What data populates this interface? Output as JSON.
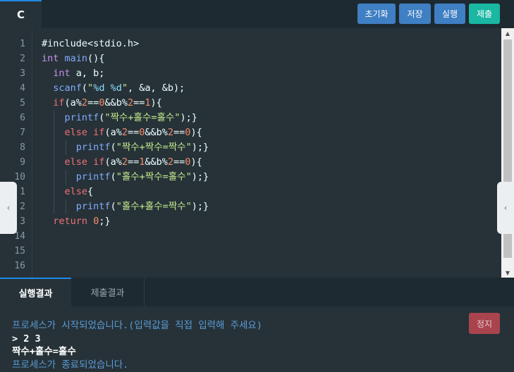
{
  "language_tab": "C",
  "toolbar": {
    "reset_label": "초기화",
    "save_label": "저장",
    "run_label": "실행",
    "submit_label": "제출"
  },
  "colors": {
    "accent": "#1e88e5",
    "run": "#3f7fc3",
    "submit": "#1ab7a3",
    "stop": "#a9444f"
  },
  "editor": {
    "line_numbers": [
      "1",
      "2",
      "3",
      "4",
      "5",
      "6",
      "7",
      "8",
      "9",
      "10",
      "1",
      "2",
      "3",
      "14",
      "15",
      "16"
    ],
    "lines": [
      "#include<stdio.h>",
      "int main(){",
      "  int a, b;",
      "  scanf(\"%d %d\", &a, &b);",
      "  if(a%2==0&&b%2==1){",
      "    printf(\"짝수+홀수=홀수\");}",
      "    else if(a%2==0&&b%2==0){",
      "      printf(\"짝수+짝수=짝수\");}",
      "    else if(a%2==1&&b%2==0){",
      "      printf(\"홀수+짝수=홀수\");}",
      "    else{",
      "      printf(\"홀수+홀수=짝수\");}",
      "  return 0;}",
      "",
      "",
      ""
    ]
  },
  "result": {
    "tab_output": "실행결과",
    "tab_submission": "제출결과",
    "stop_label": "정지",
    "lines": [
      "프로세스가 시작되었습니다.(입력값을 직접 입력해 주세요)",
      "> 2 3",
      "짝수+홀수=홀수",
      "프로세스가 종료되었습니다."
    ]
  },
  "icons": {
    "collapse_left": "chevron-left-icon",
    "collapse_right": "chevron-left-icon"
  }
}
